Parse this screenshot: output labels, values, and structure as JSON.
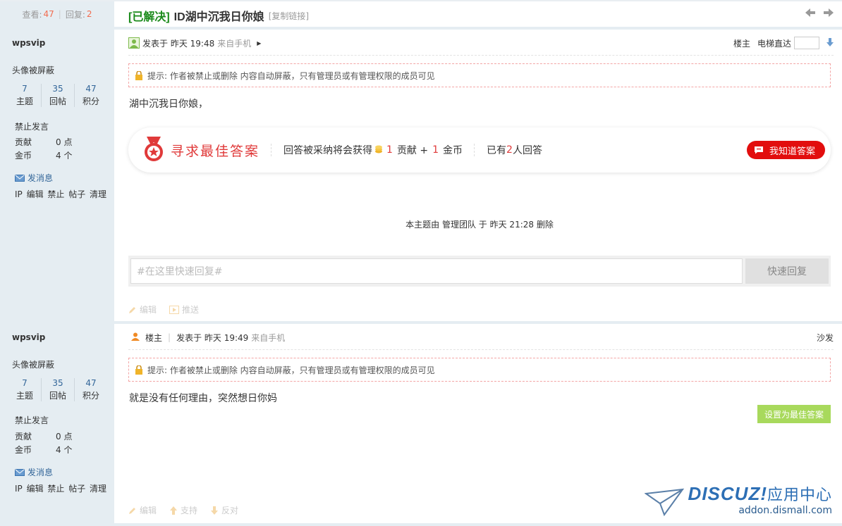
{
  "thread": {
    "views_label": "查看:",
    "views": "47",
    "replies_label": "回复:",
    "replies": "2",
    "status": "[已解决]",
    "title": "ID湖中沉我日你娘",
    "copy_link": "[复制链接]"
  },
  "colors": {
    "sidebar_bg": "#e5edf2",
    "solved_green": "#1a8a1a",
    "accent_red": "#e20e0e",
    "best_answer_green": "#a8d95c",
    "link_blue": "#336699"
  },
  "posts": [
    {
      "author": "wpsvip",
      "avatar_status": "头像被屏蔽",
      "stats": [
        {
          "value": "7",
          "label": "主题"
        },
        {
          "value": "35",
          "label": "回帖"
        },
        {
          "value": "47",
          "label": "积分"
        }
      ],
      "group": "禁止发言",
      "contribution_label": "贡献",
      "contribution": "0 点",
      "coins_label": "金币",
      "coins": "4 个",
      "send_message": "发消息",
      "admin_links": "IP 编辑 禁止 帖子 清理",
      "posted": "发表于 昨天 19:48",
      "source": "来自手机",
      "role": "楼主",
      "elevator": "电梯直达",
      "notice": "提示: 作者被禁止或删除 内容自动屏蔽，只有管理员或有管理权限的成员可见",
      "content": "湖中沉我日你娘，",
      "actions": [
        "编辑",
        "推送"
      ]
    },
    {
      "author": "wpsvip",
      "avatar_status": "头像被屏蔽",
      "stats": [
        {
          "value": "7",
          "label": "主题"
        },
        {
          "value": "35",
          "label": "回帖"
        },
        {
          "value": "47",
          "label": "积分"
        }
      ],
      "group": "禁止发言",
      "contribution_label": "贡献",
      "contribution": "0 点",
      "coins_label": "金币",
      "coins": "4 个",
      "send_message": "发消息",
      "admin_links": "IP 编辑 禁止 帖子 清理",
      "role": "楼主",
      "posted": "发表于 昨天 19:49",
      "source": "来自手机",
      "floor": "沙发",
      "notice": "提示: 作者被禁止或删除 内容自动屏蔽，只有管理员或有管理权限的成员可见",
      "content": "就是没有任何理由，突然想日你妈",
      "best_answer_button": "设置为最佳答案",
      "actions": [
        "编辑",
        "支持",
        "反对"
      ]
    }
  ],
  "reward": {
    "seek_label": "寻求最佳答案",
    "text_prefix": "回答被采纳将会获得",
    "contribution_amount": "1",
    "contribution_unit": "贡献 +",
    "coin_amount": "1",
    "coin_unit": "金币",
    "answered_prefix": "已有",
    "answered_count": "2",
    "answered_suffix": "人回答",
    "button": "我知道答案"
  },
  "deleted_notice": "本主题由 管理团队 于 昨天 21:28 删除",
  "quick_reply": {
    "placeholder": "#在这里快速回复#",
    "button": "快速回复"
  },
  "watermark": {
    "brand": "DISCUZ!",
    "brand_cn": "应用中心",
    "url": "addon.dismall.com"
  }
}
